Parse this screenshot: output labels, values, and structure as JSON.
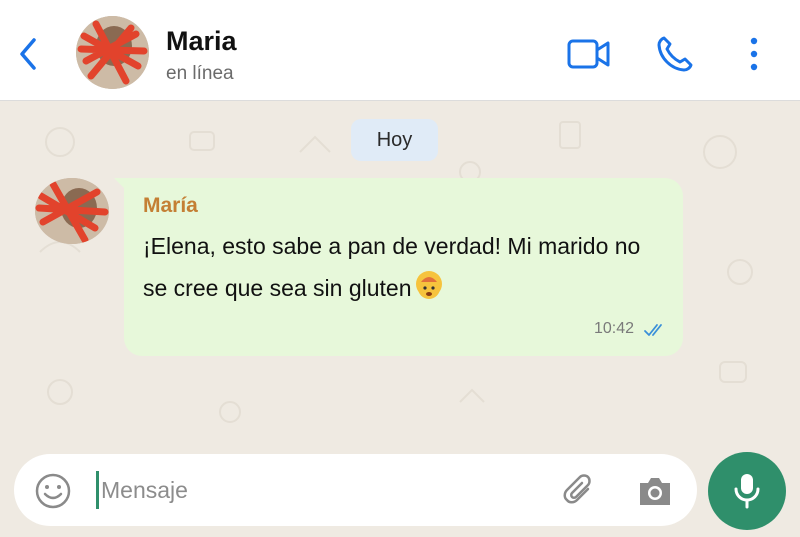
{
  "header": {
    "contact_name": "Maria",
    "status": "en línea",
    "icons": [
      "back-chevron-icon",
      "video-call-icon",
      "phone-icon",
      "more-vertical-icon"
    ]
  },
  "chat": {
    "date_chip": "Hoy",
    "message": {
      "sender": "María",
      "text": "¡Elena, esto sabe a pan de verdad! Mi marido no se cree que sea sin gluten",
      "emoji": "exploding-head-emoji",
      "time": "10:42",
      "status": "read-ticks"
    }
  },
  "composer": {
    "placeholder": "Mensaje",
    "value": "",
    "icons": [
      "emoji-icon",
      "paperclip-icon",
      "camera-icon",
      "microphone-icon"
    ]
  },
  "colors": {
    "accent": "#2f8f6b",
    "header_icons": "#1a73e8",
    "bubble": "#e7f8da",
    "sender_name": "#c47f34",
    "chat_background": "#efeae2",
    "date_chip": "#e0ebf7"
  }
}
